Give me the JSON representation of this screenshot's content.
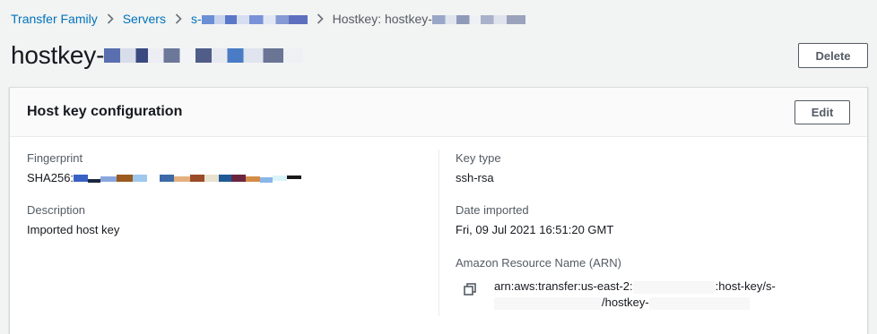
{
  "breadcrumb": {
    "items": [
      {
        "label": "Transfer Family"
      },
      {
        "label": "Servers"
      },
      {
        "label": "s-"
      }
    ],
    "current": "Hostkey: hostkey-"
  },
  "page": {
    "title": "hostkey-",
    "delete_label": "Delete"
  },
  "panel": {
    "title": "Host key configuration",
    "edit_label": "Edit",
    "fingerprint": {
      "label": "Fingerprint",
      "value": "SHA256:"
    },
    "description": {
      "label": "Description",
      "value": "Imported host key"
    },
    "key_type": {
      "label": "Key type",
      "value": "ssh-rsa"
    },
    "date_imported": {
      "label": "Date imported",
      "value": "Fri, 09 Jul 2021 16:51:20 GMT"
    },
    "arn": {
      "label": "Amazon Resource Name (ARN)",
      "part1": "arn:aws:transfer:us-east-2:",
      "part2": ":host-key/s-",
      "part3": "/hostkey-"
    }
  },
  "colors": {
    "link": "#0073bb",
    "text": "#16191f",
    "secondary": "#545b64",
    "background": "#f2f3f3",
    "border": "#d5dbdb"
  },
  "icons": {
    "chevron": "chevron-right-icon",
    "copy": "copy-icon"
  }
}
